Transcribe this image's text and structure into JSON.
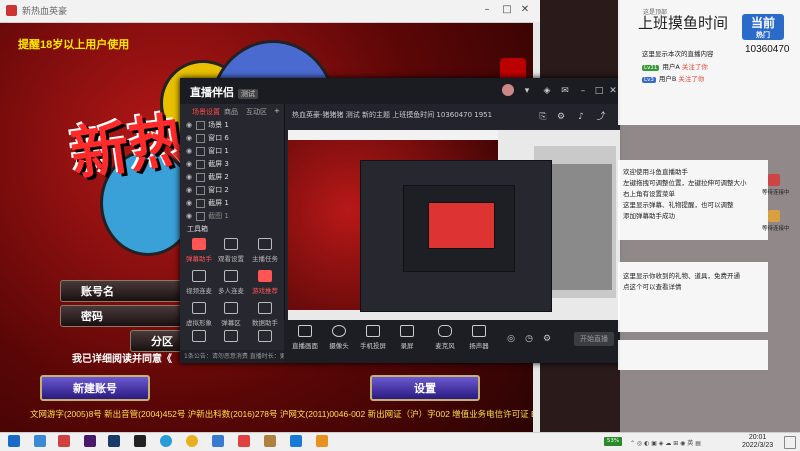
{
  "game_window": {
    "title": "新热血英豪",
    "warning": "提醒18岁以上用户使用",
    "logo_text": "新热",
    "rows": [
      "账号名",
      "密码",
      "分区"
    ],
    "agree_text": "我已详细阅读并同意《",
    "btn_new_account": "新建账号",
    "btn_settings": "设置",
    "footer": "文网游字(2005)8号  新出音管(2004)452号  沪新出科数(2016)278号  沪网文(2011)0046-002  新出网证（沪）字002  增值业务电信许可证 B2-20090046"
  },
  "app": {
    "logo": "直播伴侣",
    "beta": "测试",
    "tabs": [
      "场景设置",
      "商品",
      "互动区"
    ],
    "scenes": [
      "场景 1",
      "窗口 6",
      "窗口 1",
      "截屏 3",
      "截屏 2",
      "窗口 2",
      "截屏 1",
      "截图 1"
    ],
    "toolbox_title": "工具箱",
    "tools": [
      "弹幕助手",
      "观看设置",
      "主播任务",
      "视频连麦",
      "多人连麦",
      "游戏推荐",
      "虚拟形象",
      "弹幕区",
      "数据助手",
      "开播时间",
      "热门活动",
      "更多"
    ],
    "info": "热血英豪-猪猪猪    测试    新的主题    上班摸鱼时间    10360470    1951",
    "bottom_hint": "1条公告：请勿恶意消费    直播时长：更上一层楼",
    "controls": [
      "直播画面",
      "摄像头",
      "手机投屏",
      "录屏",
      "麦克风",
      "扬声器"
    ],
    "live_btn": "开始直播"
  },
  "chat": {
    "header_label": "这是顶部",
    "title": "上班摸鱼时间",
    "badge_main": "当前",
    "badge_sub": "热门",
    "room_id": "10360470",
    "notice": "这里显示本次的直播内容",
    "follows": [
      {
        "tag": "Lv11",
        "tag_color": "#3a9a3a",
        "name": "用户A",
        "action": "关注了你"
      },
      {
        "tag": "Lv3",
        "tag_color": "#3a6ac8",
        "name": "用户B",
        "action": "关注了你"
      }
    ],
    "mid_lines": [
      "欢迎使用斗鱼直播助手",
      "左键拖拽可调整位置，左键拉伸可调整大小",
      "右上角有设置菜单",
      "这里显示弹幕、礼物提醒，也可以调整",
      "添加弹幕助手成功"
    ],
    "low_lines": [
      "这里显示你收到的礼物、道具，免费开通",
      "点这个可以查看详情"
    ],
    "side_label_1": "等待连接中",
    "side_label_2": "等待连接中"
  },
  "taskbar": {
    "time": "20:01",
    "date": "2022/3/23",
    "net": "53%"
  }
}
